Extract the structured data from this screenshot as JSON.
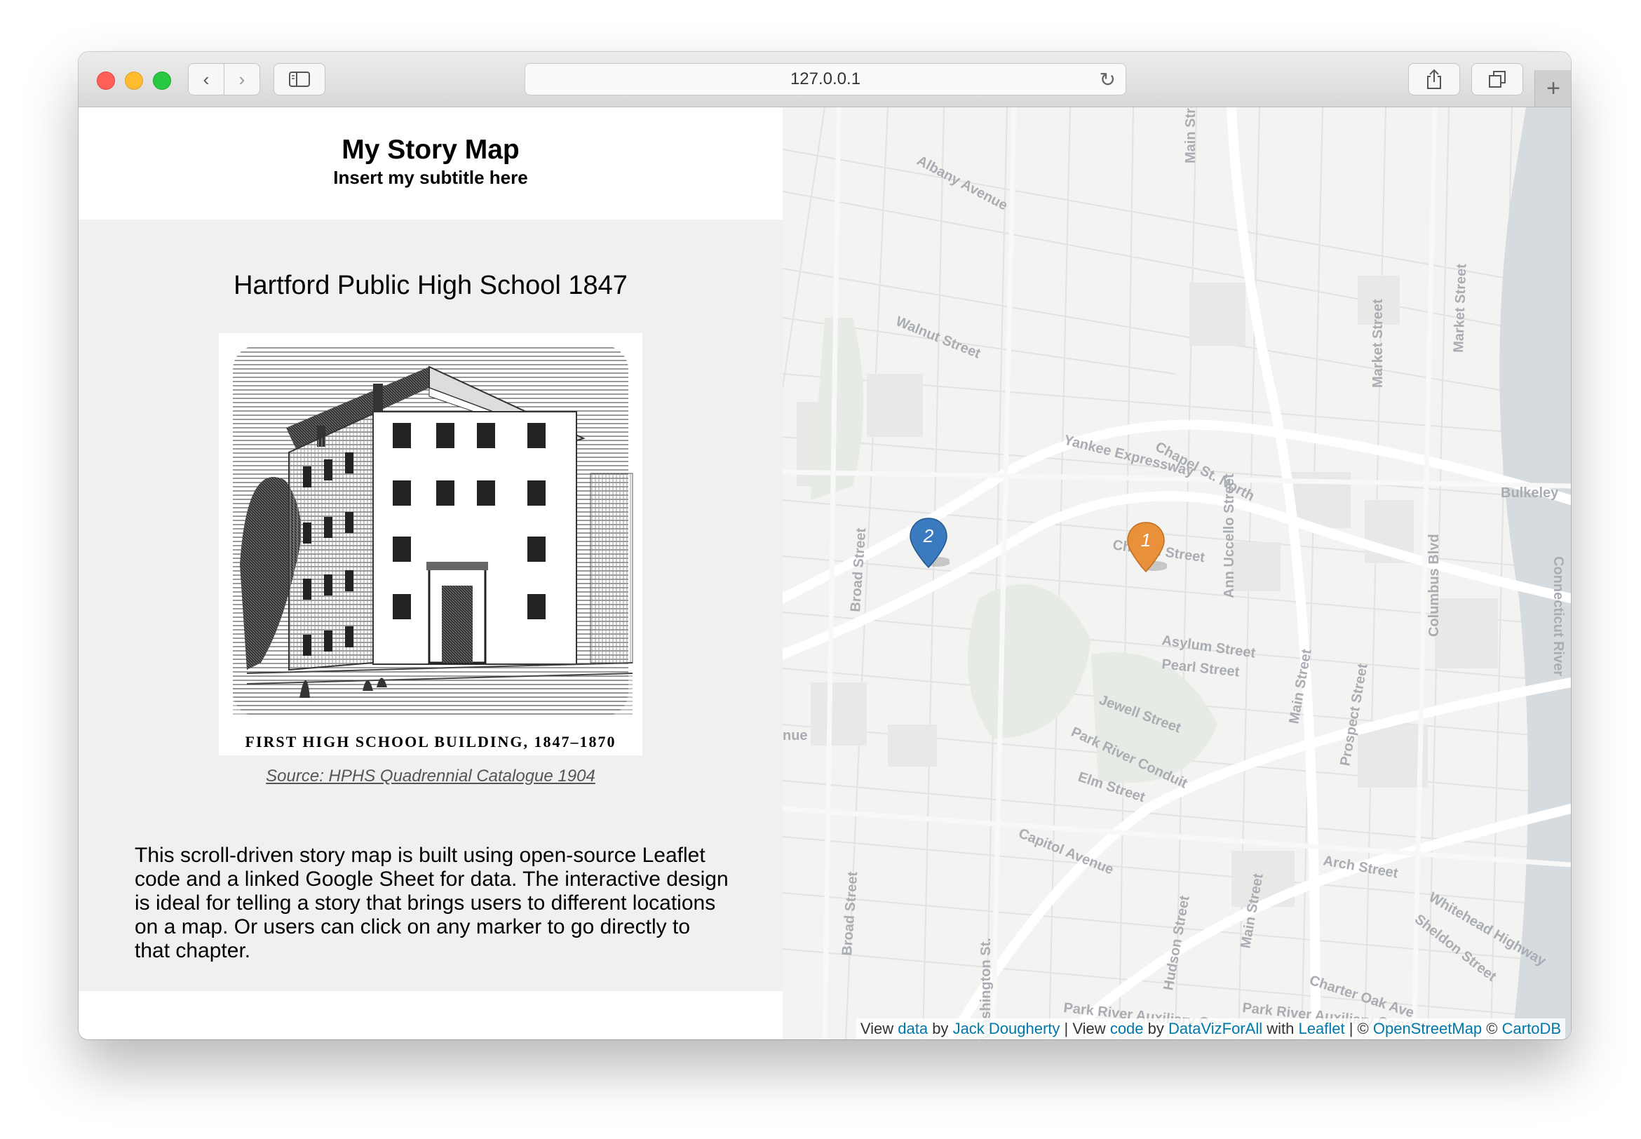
{
  "browser": {
    "url": "127.0.0.1"
  },
  "story": {
    "title": "My Story Map",
    "subtitle": "Insert my subtitle here",
    "chapter": {
      "title": "Hartford Public High School 1847",
      "image_caption": "FIRST HIGH SCHOOL BUILDING, 1847–1870",
      "source": "Source: HPHS Quadrennial Catalogue 1904",
      "description": "This scroll-driven story map is built using open-source Leaflet code and a linked Google Sheet for data. The interactive design is ideal for telling a story that brings users to different locations on a map. Or users can click on any marker to go directly to that chapter."
    }
  },
  "map": {
    "markers": [
      {
        "label": "1",
        "color": "#e8913a"
      },
      {
        "label": "2",
        "color": "#3a7bc0"
      }
    ],
    "street_labels": [
      "Albany Avenue",
      "Main Street",
      "Walnut Street",
      "Yankee Expressway",
      "Chapel St. North",
      "Church Street",
      "Asylum Street",
      "Pearl Street",
      "Jewell Street",
      "Park River Conduit",
      "Elm Street",
      "Capitol Avenue",
      "Arch Street",
      "Whitehead Highway",
      "Sheldon Street",
      "Charter Oak Ave",
      "Market Street",
      "Columbus Blvd",
      "Prospect Street",
      "Broad Street",
      "Hudson Street",
      "Ann Uccello Street",
      "Bulkeley",
      "Connecticut River",
      "Park River Auxiliary Conduit",
      "Washington St.",
      "nue"
    ],
    "attribution": {
      "view1": "View",
      "data_link": "data",
      "by1": "by",
      "author_link": "Jack Dougherty",
      "sep1": "|",
      "view2": "View",
      "code_link": "code",
      "by2": "by",
      "org_link": "DataVizForAll",
      "with": "with",
      "leaflet_link": "Leaflet",
      "sep2": "| ©",
      "osm_link": "OpenStreetMap",
      "copy": "©",
      "carto_link": "CartoDB"
    }
  }
}
